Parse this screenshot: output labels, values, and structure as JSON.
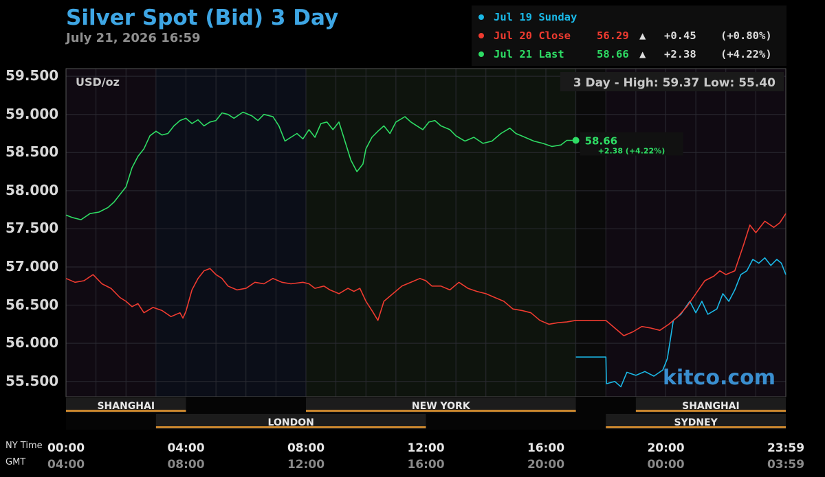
{
  "header": {
    "title": "Silver Spot (Bid) 3 Day",
    "subtitle": "July 21, 2026 16:59"
  },
  "legend": [
    {
      "label": "Jul 19 Sunday",
      "color": "#1ab8e6",
      "price": "",
      "arrow": "",
      "change": "",
      "pct": ""
    },
    {
      "label": "Jul 20 Close",
      "color": "#ef3b30",
      "price": "56.29",
      "arrow": "▲",
      "change": "+0.45",
      "pct": "(+0.80%)"
    },
    {
      "label": "Jul 21 Last",
      "color": "#2edc64",
      "price": "58.66",
      "arrow": "▲",
      "change": "+2.38",
      "pct": "(+4.22%)"
    }
  ],
  "chart_data": {
    "type": "line",
    "unit_label": "USD/oz",
    "stats_label": "3 Day - High: 59.37  Low: 55.40",
    "watermark": "kitco.com",
    "x_unit": "hours (NY time)",
    "xlim": [
      0,
      24
    ],
    "ylim": [
      55.3,
      59.6
    ],
    "y_ticks": [
      "59.500",
      "59.000",
      "58.500",
      "58.000",
      "57.500",
      "57.000",
      "56.500",
      "56.000",
      "55.500"
    ],
    "y_tick_values": [
      59.5,
      59.0,
      58.5,
      58.0,
      57.5,
      57.0,
      56.5,
      56.0,
      55.5
    ],
    "x_ticks_ny": [
      "00:00",
      "04:00",
      "08:00",
      "12:00",
      "16:00",
      "20:00",
      "23:59"
    ],
    "x_ticks_gmt": [
      "04:00",
      "08:00",
      "12:00",
      "16:00",
      "20:00",
      "00:00",
      "03:59"
    ],
    "x_tick_hours": [
      0,
      4,
      8,
      12,
      16,
      20,
      24
    ],
    "x_axis_names": [
      "NY Time",
      "GMT"
    ],
    "last_label": {
      "value": "58.66",
      "change": "+2.38 (+4.22%)"
    },
    "series": [
      {
        "name": "Jul 19 Sunday",
        "color": "#1ab8e6",
        "points": [
          [
            17,
            55.82
          ],
          [
            18,
            55.82
          ],
          [
            18.02,
            55.47
          ],
          [
            18.3,
            55.5
          ],
          [
            18.5,
            55.43
          ],
          [
            18.7,
            55.62
          ],
          [
            19,
            55.58
          ],
          [
            19.3,
            55.63
          ],
          [
            19.6,
            55.57
          ],
          [
            19.9,
            55.65
          ],
          [
            20.05,
            55.8
          ],
          [
            20.25,
            56.3
          ],
          [
            20.5,
            56.38
          ],
          [
            20.8,
            56.55
          ],
          [
            21.0,
            56.4
          ],
          [
            21.2,
            56.55
          ],
          [
            21.4,
            56.38
          ],
          [
            21.7,
            56.45
          ],
          [
            21.9,
            56.65
          ],
          [
            22.1,
            56.55
          ],
          [
            22.3,
            56.7
          ],
          [
            22.5,
            56.9
          ],
          [
            22.7,
            56.95
          ],
          [
            22.9,
            57.1
          ],
          [
            23.1,
            57.05
          ],
          [
            23.3,
            57.12
          ],
          [
            23.5,
            57.02
          ],
          [
            23.7,
            57.1
          ],
          [
            23.85,
            57.05
          ],
          [
            24,
            56.9
          ]
        ]
      },
      {
        "name": "Jul 20 Close",
        "color": "#ef3b30",
        "points": [
          [
            0,
            56.85
          ],
          [
            0.3,
            56.8
          ],
          [
            0.6,
            56.82
          ],
          [
            0.9,
            56.9
          ],
          [
            1.2,
            56.78
          ],
          [
            1.5,
            56.72
          ],
          [
            1.8,
            56.6
          ],
          [
            2.0,
            56.55
          ],
          [
            2.2,
            56.48
          ],
          [
            2.4,
            56.52
          ],
          [
            2.6,
            56.4
          ],
          [
            2.9,
            56.47
          ],
          [
            3.2,
            56.43
          ],
          [
            3.5,
            56.35
          ],
          [
            3.8,
            56.4
          ],
          [
            3.9,
            56.33
          ],
          [
            4.0,
            56.42
          ],
          [
            4.2,
            56.7
          ],
          [
            4.4,
            56.85
          ],
          [
            4.6,
            56.95
          ],
          [
            4.8,
            56.98
          ],
          [
            5.0,
            56.9
          ],
          [
            5.2,
            56.85
          ],
          [
            5.4,
            56.75
          ],
          [
            5.7,
            56.7
          ],
          [
            6.0,
            56.72
          ],
          [
            6.3,
            56.8
          ],
          [
            6.6,
            56.78
          ],
          [
            6.9,
            56.85
          ],
          [
            7.2,
            56.8
          ],
          [
            7.5,
            56.78
          ],
          [
            7.9,
            56.8
          ],
          [
            8.1,
            56.78
          ],
          [
            8.3,
            56.72
          ],
          [
            8.6,
            56.75
          ],
          [
            8.8,
            56.7
          ],
          [
            9.1,
            56.65
          ],
          [
            9.4,
            56.72
          ],
          [
            9.6,
            56.68
          ],
          [
            9.8,
            56.72
          ],
          [
            10.0,
            56.55
          ],
          [
            10.2,
            56.43
          ],
          [
            10.4,
            56.3
          ],
          [
            10.6,
            56.55
          ],
          [
            10.9,
            56.65
          ],
          [
            11.2,
            56.75
          ],
          [
            11.5,
            56.8
          ],
          [
            11.8,
            56.85
          ],
          [
            12.0,
            56.82
          ],
          [
            12.2,
            56.75
          ],
          [
            12.5,
            56.75
          ],
          [
            12.8,
            56.7
          ],
          [
            13.1,
            56.8
          ],
          [
            13.4,
            56.72
          ],
          [
            13.7,
            56.68
          ],
          [
            14.0,
            56.65
          ],
          [
            14.3,
            56.6
          ],
          [
            14.6,
            56.55
          ],
          [
            14.9,
            56.45
          ],
          [
            15.2,
            56.43
          ],
          [
            15.5,
            56.4
          ],
          [
            15.8,
            56.3
          ],
          [
            16.1,
            56.25
          ],
          [
            16.4,
            56.27
          ],
          [
            16.7,
            56.28
          ],
          [
            17,
            56.3
          ],
          [
            18,
            56.3
          ],
          [
            18.3,
            56.2
          ],
          [
            18.6,
            56.1
          ],
          [
            18.9,
            56.15
          ],
          [
            19.2,
            56.22
          ],
          [
            19.5,
            56.2
          ],
          [
            19.8,
            56.17
          ],
          [
            20.1,
            56.25
          ],
          [
            20.4,
            56.35
          ],
          [
            20.7,
            56.48
          ],
          [
            21.0,
            56.65
          ],
          [
            21.3,
            56.82
          ],
          [
            21.6,
            56.88
          ],
          [
            21.8,
            56.95
          ],
          [
            22.0,
            56.9
          ],
          [
            22.3,
            56.95
          ],
          [
            22.6,
            57.3
          ],
          [
            22.8,
            57.55
          ],
          [
            23.0,
            57.45
          ],
          [
            23.3,
            57.6
          ],
          [
            23.6,
            57.52
          ],
          [
            23.8,
            57.58
          ],
          [
            24,
            57.7
          ]
        ]
      },
      {
        "name": "Jul 21 Last",
        "color": "#2edc64",
        "points": [
          [
            0,
            57.68
          ],
          [
            0.2,
            57.65
          ],
          [
            0.5,
            57.62
          ],
          [
            0.8,
            57.7
          ],
          [
            1.1,
            57.72
          ],
          [
            1.4,
            57.78
          ],
          [
            1.6,
            57.85
          ],
          [
            1.8,
            57.95
          ],
          [
            2.0,
            58.05
          ],
          [
            2.2,
            58.3
          ],
          [
            2.4,
            58.45
          ],
          [
            2.6,
            58.55
          ],
          [
            2.8,
            58.72
          ],
          [
            3.0,
            58.78
          ],
          [
            3.2,
            58.73
          ],
          [
            3.4,
            58.75
          ],
          [
            3.6,
            58.85
          ],
          [
            3.8,
            58.92
          ],
          [
            4.0,
            58.95
          ],
          [
            4.2,
            58.88
          ],
          [
            4.4,
            58.93
          ],
          [
            4.6,
            58.85
          ],
          [
            4.8,
            58.9
          ],
          [
            5.0,
            58.92
          ],
          [
            5.2,
            59.02
          ],
          [
            5.4,
            59.0
          ],
          [
            5.6,
            58.95
          ],
          [
            5.9,
            59.03
          ],
          [
            6.2,
            58.98
          ],
          [
            6.4,
            58.92
          ],
          [
            6.6,
            59.0
          ],
          [
            6.9,
            58.97
          ],
          [
            7.1,
            58.85
          ],
          [
            7.3,
            58.65
          ],
          [
            7.5,
            58.7
          ],
          [
            7.7,
            58.75
          ],
          [
            7.9,
            58.68
          ],
          [
            8.1,
            58.8
          ],
          [
            8.3,
            58.7
          ],
          [
            8.5,
            58.88
          ],
          [
            8.7,
            58.9
          ],
          [
            8.9,
            58.8
          ],
          [
            9.1,
            58.9
          ],
          [
            9.3,
            58.65
          ],
          [
            9.5,
            58.4
          ],
          [
            9.7,
            58.25
          ],
          [
            9.9,
            58.35
          ],
          [
            10.0,
            58.55
          ],
          [
            10.2,
            58.7
          ],
          [
            10.4,
            58.78
          ],
          [
            10.6,
            58.85
          ],
          [
            10.8,
            58.75
          ],
          [
            11.0,
            58.9
          ],
          [
            11.3,
            58.97
          ],
          [
            11.5,
            58.9
          ],
          [
            11.7,
            58.85
          ],
          [
            11.9,
            58.8
          ],
          [
            12.1,
            58.9
          ],
          [
            12.3,
            58.92
          ],
          [
            12.5,
            58.85
          ],
          [
            12.8,
            58.8
          ],
          [
            13.0,
            58.72
          ],
          [
            13.3,
            58.65
          ],
          [
            13.6,
            58.7
          ],
          [
            13.9,
            58.62
          ],
          [
            14.2,
            58.65
          ],
          [
            14.5,
            58.75
          ],
          [
            14.8,
            58.82
          ],
          [
            15.0,
            58.75
          ],
          [
            15.3,
            58.7
          ],
          [
            15.6,
            58.65
          ],
          [
            15.9,
            58.62
          ],
          [
            16.2,
            58.58
          ],
          [
            16.5,
            58.6
          ],
          [
            16.7,
            58.66
          ],
          [
            17,
            58.66
          ]
        ]
      }
    ],
    "sessions": [
      {
        "name": "SHANGHAI",
        "row": 1,
        "start": 0,
        "end": 4
      },
      {
        "name": "NEW YORK",
        "row": 1,
        "start": 8,
        "end": 17
      },
      {
        "name": "SHANGHAI",
        "row": 1,
        "start": 19,
        "end": 24
      },
      {
        "name": "LONDON",
        "row": 2,
        "start": 3,
        "end": 12
      },
      {
        "name": "SYDNEY",
        "row": 2,
        "start": 18,
        "end": 24
      }
    ],
    "background_bands": [
      {
        "start": 0,
        "end": 3,
        "color": "#100a12"
      },
      {
        "start": 3,
        "end": 8,
        "color": "#0b0e18"
      },
      {
        "start": 8,
        "end": 17,
        "color": "#0e140d"
      },
      {
        "start": 17,
        "end": 18,
        "color": "#0a0a0a"
      },
      {
        "start": 18,
        "end": 24,
        "color": "#100a12"
      }
    ]
  }
}
